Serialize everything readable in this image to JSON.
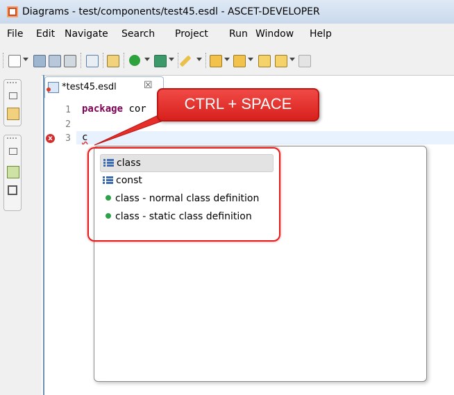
{
  "window": {
    "title": "Diagrams - test/components/test45.esdl - ASCET-DEVELOPER"
  },
  "menu": [
    "File",
    "Edit",
    "Navigate",
    "Search",
    "Project",
    "Run",
    "Window",
    "Help"
  ],
  "toolbar": {
    "icons": [
      "new-wizard-icon",
      "save-icon",
      "save-all-icon",
      "print-icon",
      "generate-code-icon",
      "run-last-icon",
      "run-icon",
      "external-tools-icon",
      "annotation-pen-icon",
      "next-annotation-icon",
      "previous-annotation-icon",
      "last-edit-icon",
      "back-icon",
      "forward-icon"
    ]
  },
  "sidebar": {
    "icons": [
      "restore-icon",
      "package-explorer-icon",
      "restore-icon",
      "outline-icon",
      "components-icon"
    ]
  },
  "editor": {
    "tab_label": "*test45.esdl",
    "tab_close": "☒",
    "line_numbers": [
      "1",
      "2",
      "3"
    ],
    "line1_keyword": "package",
    "line1_rest": "cor",
    "line3_text": "c",
    "error_marker": "x"
  },
  "callout": {
    "text": "CTRL + SPACE"
  },
  "proposals": [
    {
      "label": "class",
      "kind": "keyword",
      "selected": true
    },
    {
      "label": "const",
      "kind": "keyword",
      "selected": false
    },
    {
      "label": "class - normal class definition",
      "kind": "template",
      "selected": false
    },
    {
      "label": "class - static class definition",
      "kind": "template",
      "selected": false
    }
  ],
  "colors": {
    "callout": "#e62e2a",
    "highlight_border": "#e31d1d",
    "keyword": "#7f0055",
    "template_dot": "#2ea24a"
  }
}
